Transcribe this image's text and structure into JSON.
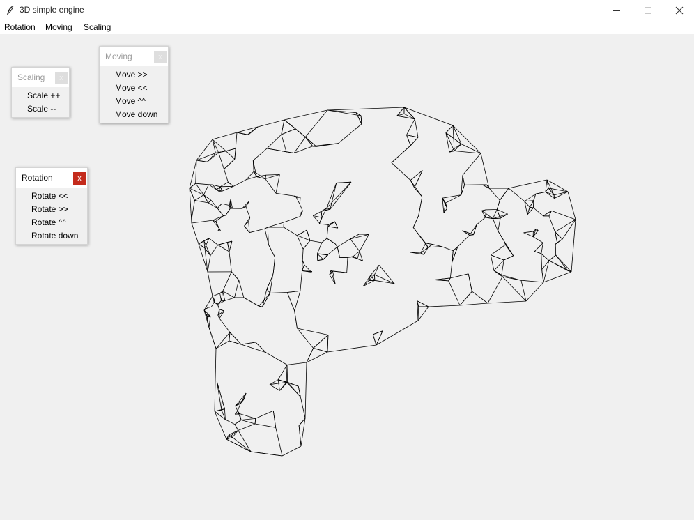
{
  "window": {
    "title": "3D simple engine",
    "app_icon": "feather-icon",
    "controls": [
      "minimize-icon",
      "maximize-icon",
      "close-icon"
    ]
  },
  "menubar": {
    "items": [
      {
        "label": "Rotation"
      },
      {
        "label": "Moving"
      },
      {
        "label": "Scaling"
      }
    ]
  },
  "popups": {
    "scaling": {
      "title": "Scaling",
      "close": "x",
      "items": [
        "Scale ++",
        "Scale --"
      ]
    },
    "moving": {
      "title": "Moving",
      "close": "x",
      "items": [
        "Move >>",
        "Move <<",
        "Move ^^",
        "Move down"
      ]
    },
    "rotation": {
      "title": "Rotation",
      "close": "x",
      "items": [
        "Rotate <<",
        "Rotate >>",
        "Rotate ^^",
        "Rotate down"
      ]
    }
  },
  "colors": {
    "background": "#f0f0f0",
    "wireframe": "#000000",
    "close_active": "#c42b1c"
  }
}
